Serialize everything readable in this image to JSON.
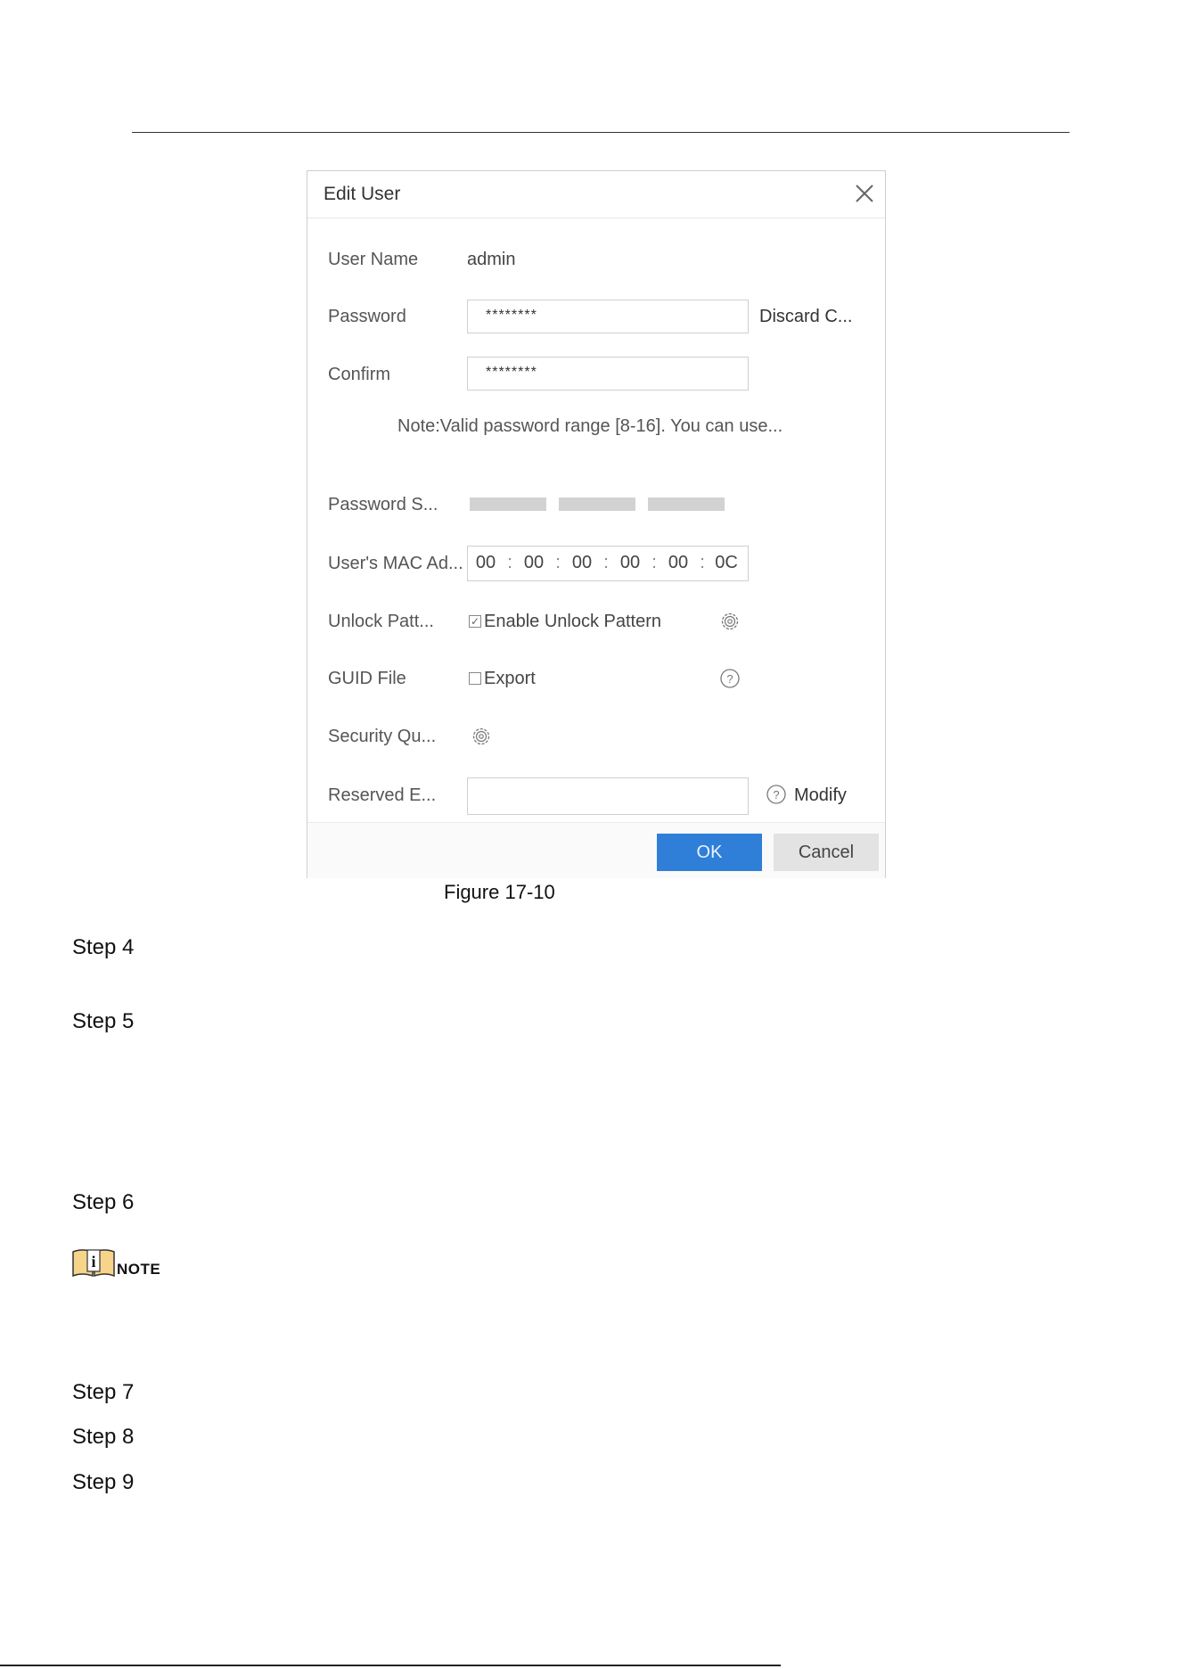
{
  "dialog": {
    "title": "Edit User",
    "user_name_label": "User Name",
    "user_name_value": "admin",
    "password_label": "Password",
    "password_value": "********",
    "discard_label": "Discard C...",
    "confirm_label": "Confirm",
    "confirm_value": "********",
    "note": "Note:Valid password range [8-16]. You can use...",
    "strength_label": "Password S...",
    "mac_label": "User's MAC Ad...",
    "mac_segments": [
      "00",
      "00",
      "00",
      "00",
      "00",
      "0C"
    ],
    "mac_separator": ":",
    "unlock_label": "Unlock Patt...",
    "unlock_checkbox_label": "Enable Unlock Pattern",
    "unlock_checked": true,
    "guid_label": "GUID File",
    "guid_checkbox_label": "Export",
    "guid_checked": false,
    "security_label": "Security Qu...",
    "reserved_label": "Reserved E...",
    "reserved_value": "",
    "modify_label": "Modify",
    "ok_label": "OK",
    "cancel_label": "Cancel",
    "icons": {
      "close": "close-icon",
      "gear": "gear-icon",
      "help": "help-icon"
    },
    "colors": {
      "ok_button": "#2f7fd8",
      "cancel_button": "#e3e3e3",
      "strength_bars": "#d2d2d2"
    }
  },
  "caption": "Figure 17-10",
  "steps": [
    "Step 4",
    "Step 5",
    "Step 6",
    "Step 7",
    "Step 8",
    "Step 9"
  ],
  "note_label": "NOTE"
}
